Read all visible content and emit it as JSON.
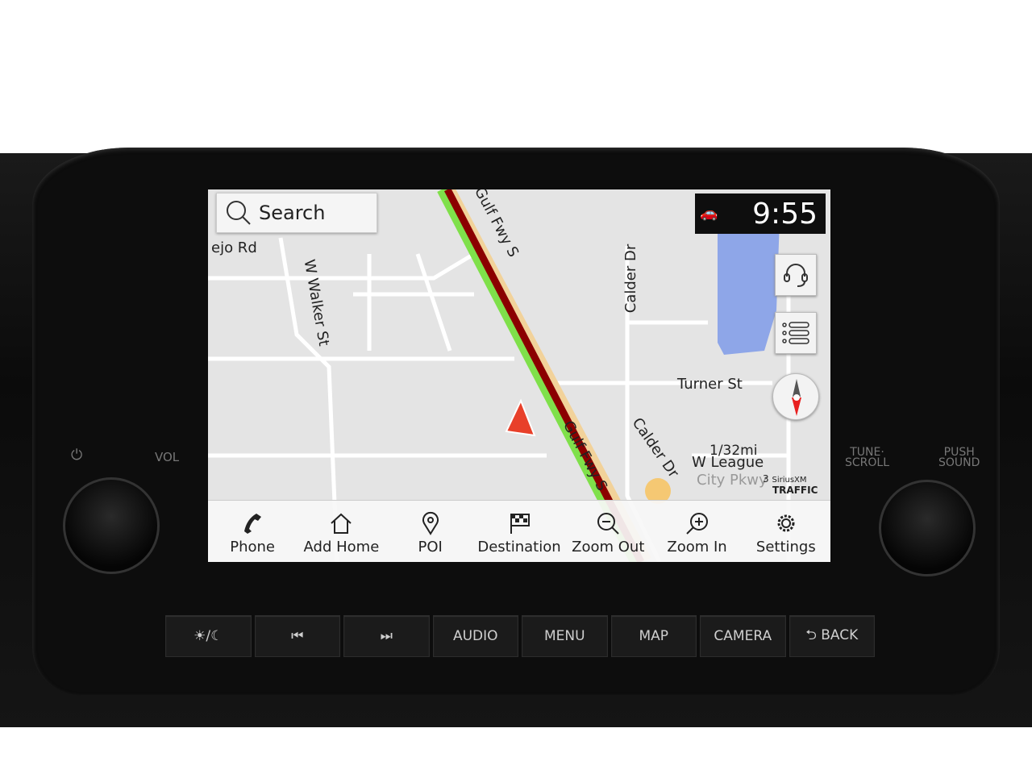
{
  "search": {
    "label": "Search",
    "icon": "search-icon"
  },
  "status": {
    "time": "9:55",
    "icon": "car-connected-icon"
  },
  "map": {
    "labels": {
      "road1": "ejo Rd",
      "road2": "W Walker St",
      "road3": "Gulf Fwy S",
      "road4": "Calder Dr",
      "road5": "Turner St",
      "road6": "Calder Dr",
      "road7": "W League",
      "road8": "City Pkwy",
      "road9": "Gulf Fwy S"
    },
    "scale": "1/32mi",
    "traffic": {
      "count": "3",
      "brand": "SiriusXM",
      "label": "TRAFFIC"
    },
    "colors": {
      "route": "#8b0000",
      "water": "#8ea6e8",
      "position_arrow": "#e8402a"
    }
  },
  "side_buttons": [
    {
      "icon": "headset-icon"
    },
    {
      "icon": "list-icon"
    },
    {
      "icon": "compass-icon"
    }
  ],
  "nav_bar": [
    {
      "label": "Phone",
      "icon": "phone-icon"
    },
    {
      "label": "Add Home",
      "icon": "home-add-icon"
    },
    {
      "label": "POI",
      "icon": "location-pin-icon"
    },
    {
      "label": "Destination",
      "icon": "checkered-flag-icon"
    },
    {
      "label": "Zoom Out",
      "icon": "zoom-out-icon"
    },
    {
      "label": "Zoom In",
      "icon": "zoom-in-icon"
    },
    {
      "label": "Settings",
      "icon": "gear-icon"
    }
  ],
  "hard_buttons": [
    {
      "label": "☀/☾",
      "icon": "day-night-icon"
    },
    {
      "label": "⏮",
      "icon": "previous-track-icon"
    },
    {
      "label": "⏭",
      "icon": "next-track-icon"
    },
    {
      "label": "AUDIO"
    },
    {
      "label": "MENU"
    },
    {
      "label": "MAP"
    },
    {
      "label": "CAMERA"
    },
    {
      "label": "⮌ BACK",
      "icon": "back-icon"
    }
  ],
  "knobs": {
    "left_label": "VOL",
    "right_label1": "TUNE·\nSCROLL",
    "right_label2": "PUSH\nSOUND"
  }
}
